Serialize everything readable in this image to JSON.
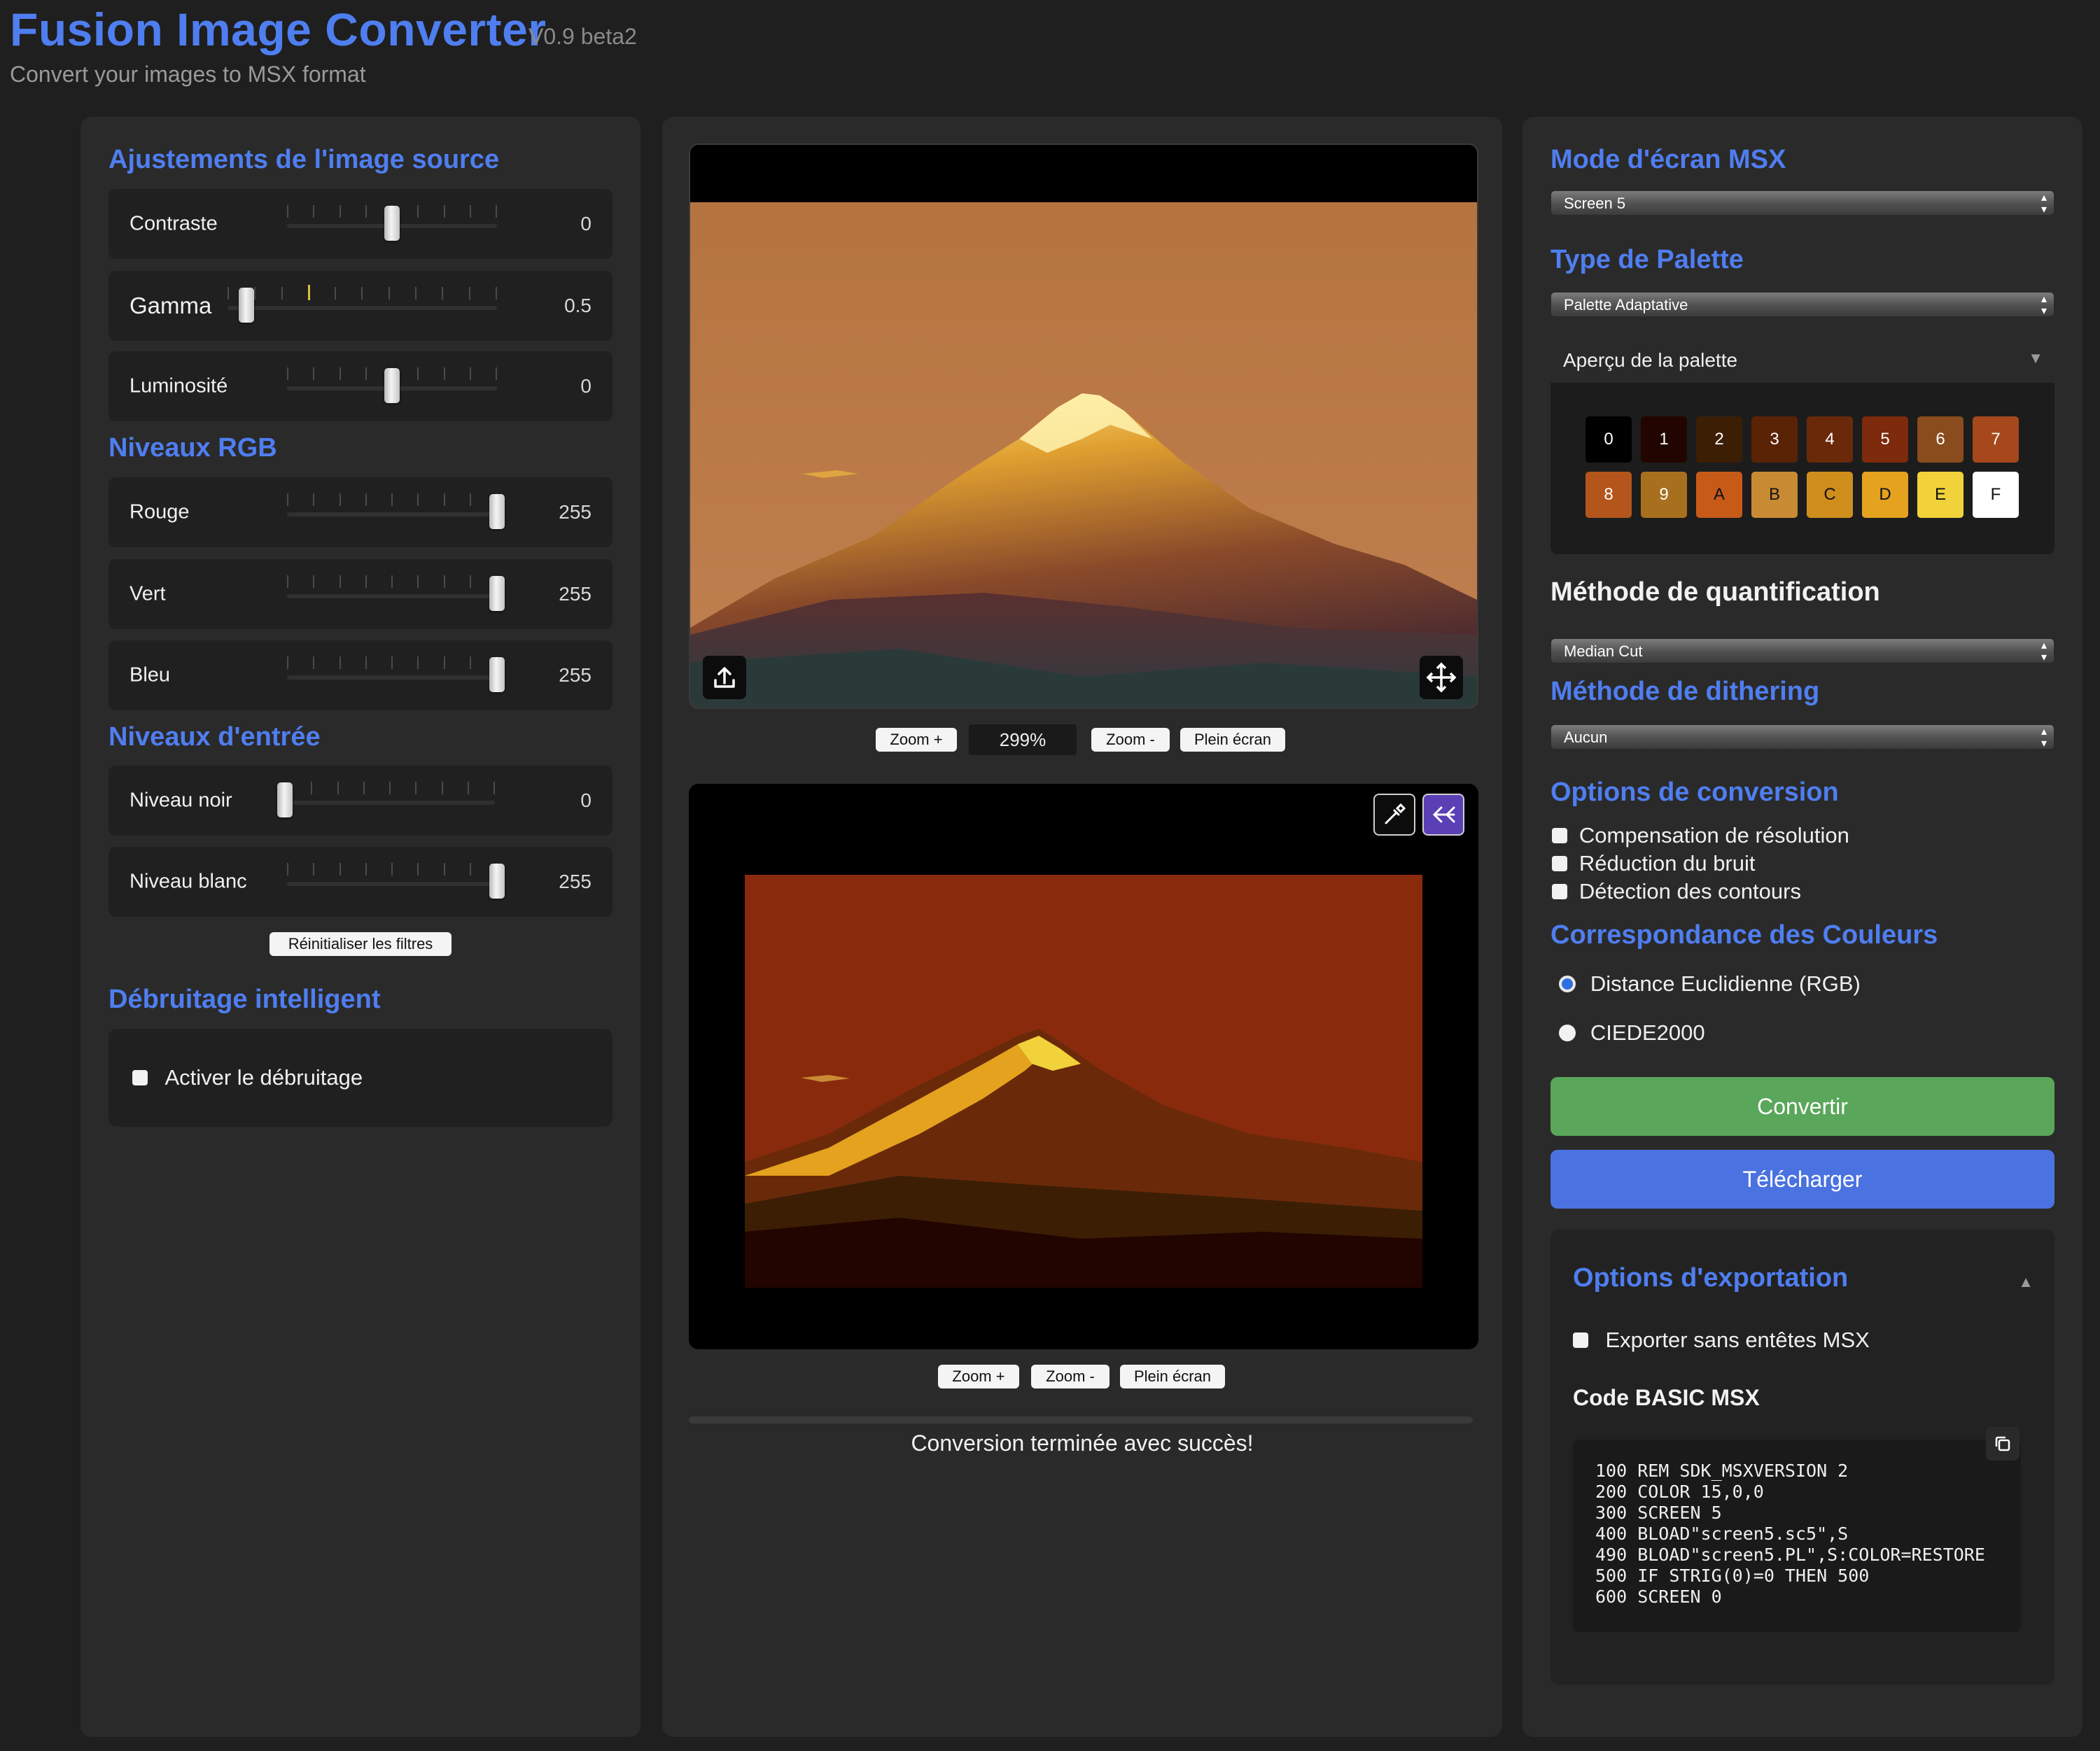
{
  "app": {
    "title": "Fusion Image Converter",
    "version": "V0.9 beta2",
    "subtitle": "Convert your images to MSX format"
  },
  "left": {
    "source_title": "Ajustements de l'image source",
    "contrast": {
      "label": "Contraste",
      "value": "0",
      "level": 0.5
    },
    "gamma": {
      "label": "Gamma",
      "value": "0.5",
      "level": 0.07
    },
    "brightness": {
      "label": "Luminosité",
      "value": "0",
      "level": 0.5
    },
    "rgb_title": "Niveaux RGB",
    "red": {
      "label": "Rouge",
      "value": "255",
      "level": 1.0
    },
    "green": {
      "label": "Vert",
      "value": "255",
      "level": 1.0
    },
    "blue": {
      "label": "Bleu",
      "value": "255",
      "level": 1.0
    },
    "input_title": "Niveaux d'entrée",
    "black": {
      "label": "Niveau noir",
      "value": "0",
      "level": 0.0
    },
    "white": {
      "label": "Niveau blanc",
      "value": "255",
      "level": 1.0
    },
    "reset_label": "Réinitialiser les filtres",
    "denoise_title": "Débruitage intelligent",
    "denoise_label": "Activer le débruitage"
  },
  "center": {
    "zoom_in": "Zoom +",
    "zoom_value": "299%",
    "zoom_out": "Zoom -",
    "fullscreen": "Plein écran",
    "zoom_in_2": "Zoom +",
    "zoom_out_2": "Zoom -",
    "fullscreen_2": "Plein écran",
    "status": "Conversion terminée avec succès!"
  },
  "right": {
    "screen_title": "Mode d'écran MSX",
    "screen_value": "Screen 5",
    "palette_title": "Type de Palette",
    "palette_value": "Palette Adaptative",
    "palette_preview_label": "Aperçu de la palette",
    "palette_arrow": "▼",
    "swatches": [
      {
        "label": "0",
        "color": "#000000",
        "text": "#ffffff"
      },
      {
        "label": "1",
        "color": "#220500",
        "text": "#ffffff"
      },
      {
        "label": "2",
        "color": "#3c1e05",
        "text": "#ffffff"
      },
      {
        "label": "3",
        "color": "#5a2306",
        "text": "#ffffff"
      },
      {
        "label": "4",
        "color": "#6a2a0a",
        "text": "#ffffff"
      },
      {
        "label": "5",
        "color": "#7e2a0c",
        "text": "#ffffff"
      },
      {
        "label": "6",
        "color": "#8a4c1c",
        "text": "#ffffff"
      },
      {
        "label": "7",
        "color": "#a6481c",
        "text": "#ffffff"
      },
      {
        "label": "8",
        "color": "#b4561c",
        "text": "#ffffff"
      },
      {
        "label": "9",
        "color": "#a8701e",
        "text": "#ffffff"
      },
      {
        "label": "A",
        "color": "#c85a18",
        "text": "#111111"
      },
      {
        "label": "B",
        "color": "#c98a34",
        "text": "#111111"
      },
      {
        "label": "C",
        "color": "#cf8e1c",
        "text": "#111111"
      },
      {
        "label": "D",
        "color": "#e4a21e",
        "text": "#111111"
      },
      {
        "label": "E",
        "color": "#f2d23a",
        "text": "#111111"
      },
      {
        "label": "F",
        "color": "#ffffff",
        "text": "#111111"
      }
    ],
    "quant_title": "Méthode de quantification",
    "quant_value": "Median Cut",
    "dither_title": "Méthode de dithering",
    "dither_value": "Aucun",
    "conv_title": "Options de conversion",
    "opt_resolution": "Compensation de résolution",
    "opt_noise": "Réduction du bruit",
    "opt_edges": "Détection des contours",
    "match_title": "Correspondance des Couleurs",
    "match_euclid": "Distance Euclidienne (RGB)",
    "match_ciede": "CIEDE2000",
    "convert_label": "Convertir",
    "download_label": "Télécharger",
    "export_title": "Options d'exportation",
    "export_arrow": "▲",
    "export_noheader": "Exporter sans entêtes MSX",
    "basic_title": "Code BASIC MSX",
    "basic_code": "100 REM SDK_MSXVERSION 2\n200 COLOR 15,0,0\n300 SCREEN 5\n400 BLOAD\"screen5.sc5\",S\n490 BLOAD\"screen5.PL\",S:COLOR=RESTORE\n500 IF STRIG(0)=0 THEN 500\n600 SCREEN 0"
  },
  "colors": {
    "accent": "#4f7ef0",
    "convert": "#5aa65a",
    "download": "#4a72e0",
    "picker_active": "#5b3fb5"
  }
}
